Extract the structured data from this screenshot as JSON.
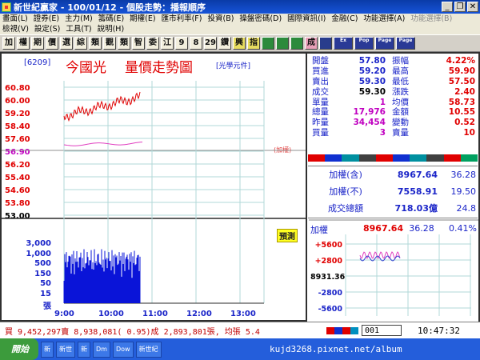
{
  "window": {
    "title": "新世紀贏家 - 100/01/12 - 個股走勢：播報順序"
  },
  "menu": {
    "row1": [
      "畫面(L)",
      "證券(E)",
      "主力(M)",
      "籌碼(E)",
      "期權(E)",
      "匯市利率(F)",
      "投資(B)",
      "操盤密碼(D)",
      "國際資訊(I)",
      "金融(C)",
      "功能選擇(A)"
    ],
    "row1_disabled": "功能選擇(B)",
    "row2": [
      "檢視(V)",
      "設定(S)",
      "工具(T)",
      "說明(H)"
    ]
  },
  "toolbar": {
    "buttons": [
      "加",
      "權",
      "期",
      "價",
      "選",
      "綜",
      "類",
      "觀",
      "類",
      "智",
      "委",
      "江",
      "9",
      "8",
      "29",
      "鑽",
      "興",
      "指",
      "",
      "",
      "",
      "成",
      "",
      "Ex",
      "Pop",
      "Page",
      "Page"
    ]
  },
  "chart": {
    "stock_code": "[6209]",
    "stock_name": "今國光",
    "title": "量價走勢圖",
    "unit": "[光學元件]",
    "ref_tag": "(加權)",
    "tag_button": "預測",
    "price_ticks": [
      "60.80",
      "60.00",
      "59.20",
      "58.40",
      "57.60",
      "56.90",
      "56.20",
      "55.40",
      "54.60",
      "53.80",
      "53.00"
    ],
    "volume_ticks": [
      "3,000",
      "1,000",
      "500",
      "150",
      "50",
      "15",
      "張"
    ],
    "time_ticks": [
      "9:00",
      "10:00",
      "11:00",
      "12:00",
      "13:00"
    ]
  },
  "quotes": [
    {
      "l1": "開盤",
      "v1": "57.80",
      "l2": "振幅",
      "v2": "4.22%"
    },
    {
      "l1": "買進",
      "v1": "59.20",
      "l2": "最高",
      "v2": "59.90"
    },
    {
      "l1": "賣出",
      "v1": "59.30",
      "l2": "最低",
      "v2": "57.50"
    },
    {
      "l1": "成交",
      "v1": "59.30",
      "l2": "漲跌",
      "v2": "2.40"
    },
    {
      "l1": "單量",
      "v1": "1",
      "l2": "均價",
      "v2": "58.73"
    },
    {
      "l1": "總量",
      "v1": "17,976",
      "l2": "金額",
      "v2": "10.55"
    },
    {
      "l1": "昨量",
      "v1": "34,454",
      "l2": "變動",
      "v2": "0.52"
    },
    {
      "l1": "買量",
      "v1": "3",
      "l2": "賣量",
      "v2": "10"
    }
  ],
  "index": [
    {
      "label": "加權(含)",
      "value": "8967.64",
      "change": "36.28"
    },
    {
      "label": "加權(不)",
      "value": "7558.91",
      "change": "19.50"
    },
    {
      "label": "成交總額",
      "value": "718.03億",
      "change": "24.8"
    }
  ],
  "mini": {
    "label": "加權",
    "value": "8967.64",
    "change": "36.28",
    "pct": "0.41%",
    "ticks": [
      "+5600",
      "+2800",
      "8931.36",
      "-2800",
      "-5600"
    ]
  },
  "status": {
    "text": "買 9,452,297賣 8,938,081( 0.95)成 2,893,801張, 均張 5.4",
    "input": "001",
    "time": "10:47:32"
  },
  "taskbar": {
    "start": "開始",
    "items": [
      "新",
      "新世",
      "新",
      "Dm",
      "Dow",
      "新世紀"
    ]
  },
  "watermark": "kujd3268.pixnet.net/album"
}
